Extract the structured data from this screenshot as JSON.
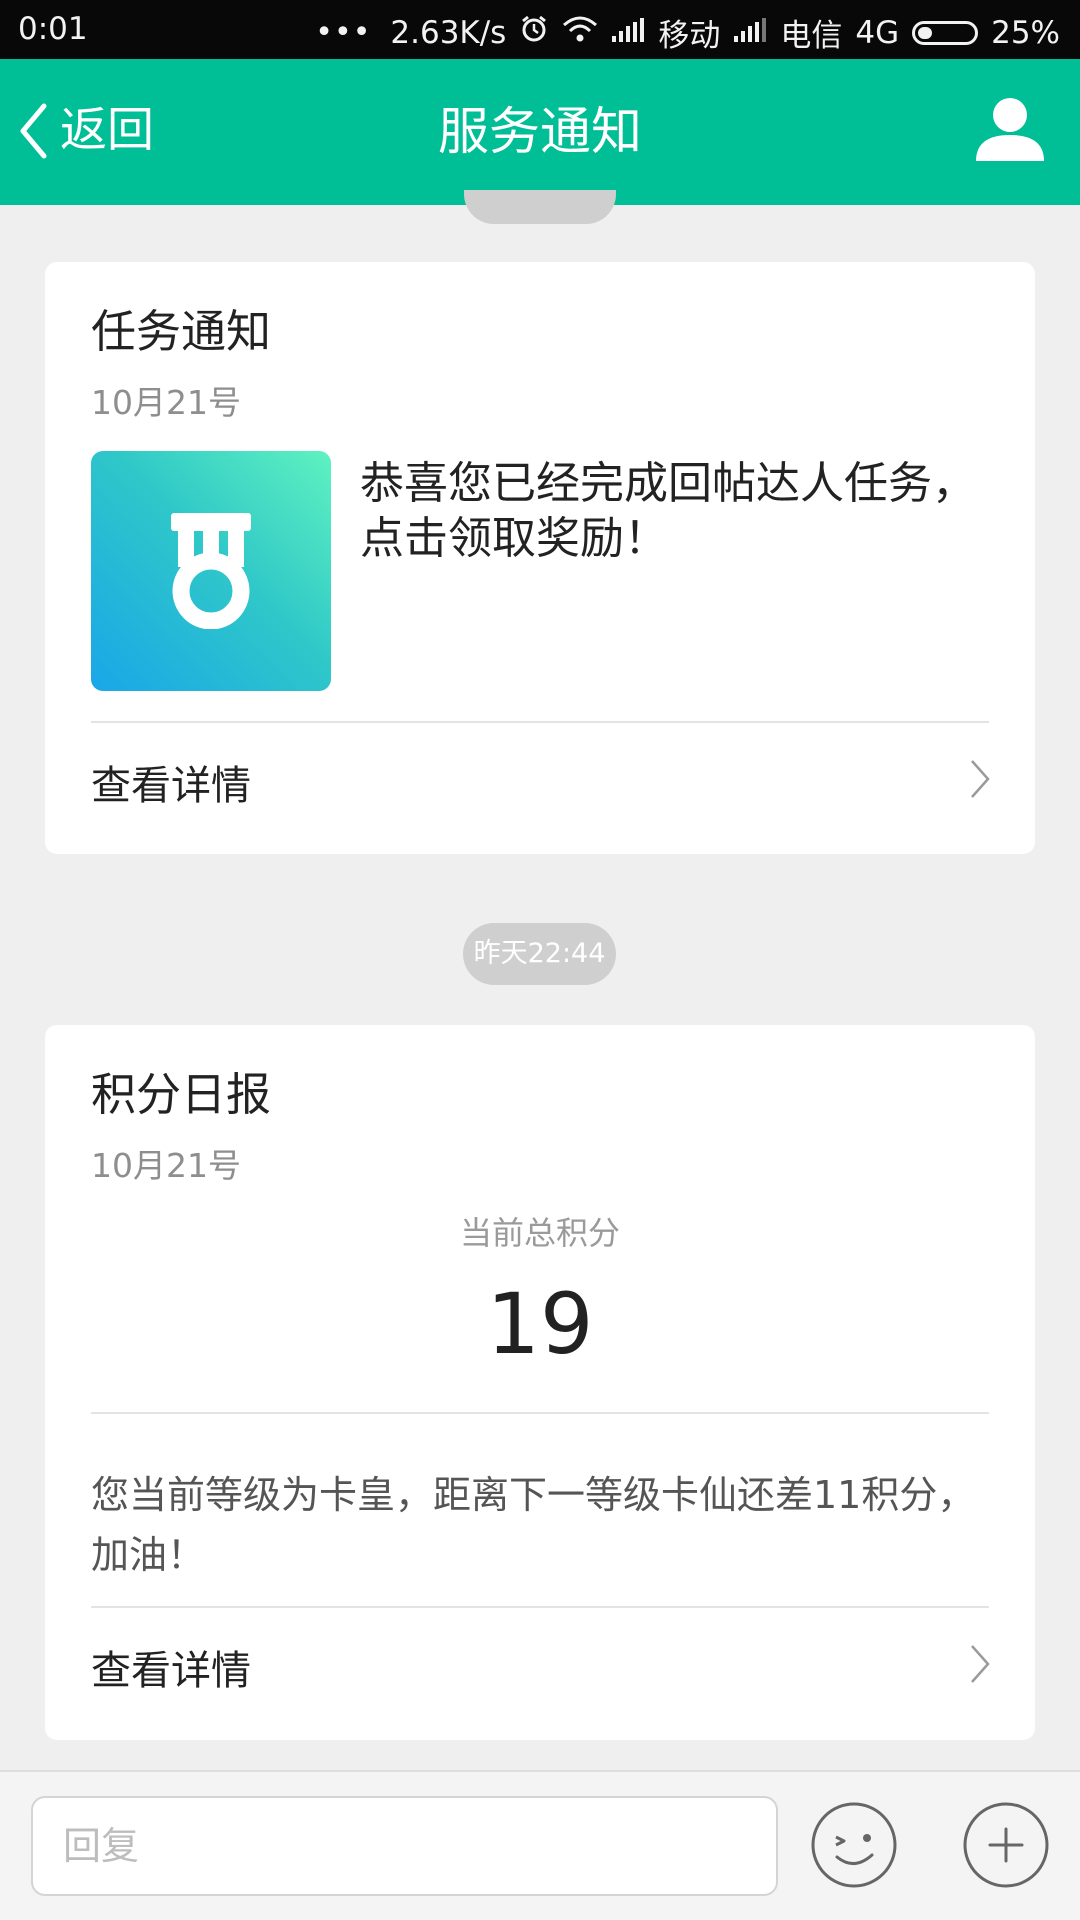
{
  "status_bar": {
    "time": "0:01",
    "dots": "•••",
    "speed": "2.63K/s",
    "carrier1": "移动",
    "carrier2": "电信",
    "network": "4G",
    "battery": "25%",
    "battery_level": 0.25
  },
  "header": {
    "back_label": "返回",
    "title": "服务通知",
    "back_icon": "chevron-left-icon",
    "user_icon": "user-icon"
  },
  "task_card": {
    "title": "任务通知",
    "date": "10月21号",
    "icon": "medal-icon",
    "message": "恭喜您已经完成回帖达人任务，点击领取奖励！",
    "detail_label": "查看详情"
  },
  "timestamp": "昨天22:44",
  "score_card": {
    "title": "积分日报",
    "date": "10月21号",
    "score_caption": "当前总积分",
    "score_value": "19",
    "level_message": "您当前等级为卡皇，距离下一等级卡仙还差11积分，加油！",
    "detail_label": "查看详情"
  },
  "input_bar": {
    "placeholder": "回复",
    "emoji_icon": "emoji-icon",
    "plus_icon": "plus-icon"
  },
  "colors": {
    "header_bg": "#00be96",
    "status_bg": "#080808",
    "page_bg": "#efefef"
  }
}
